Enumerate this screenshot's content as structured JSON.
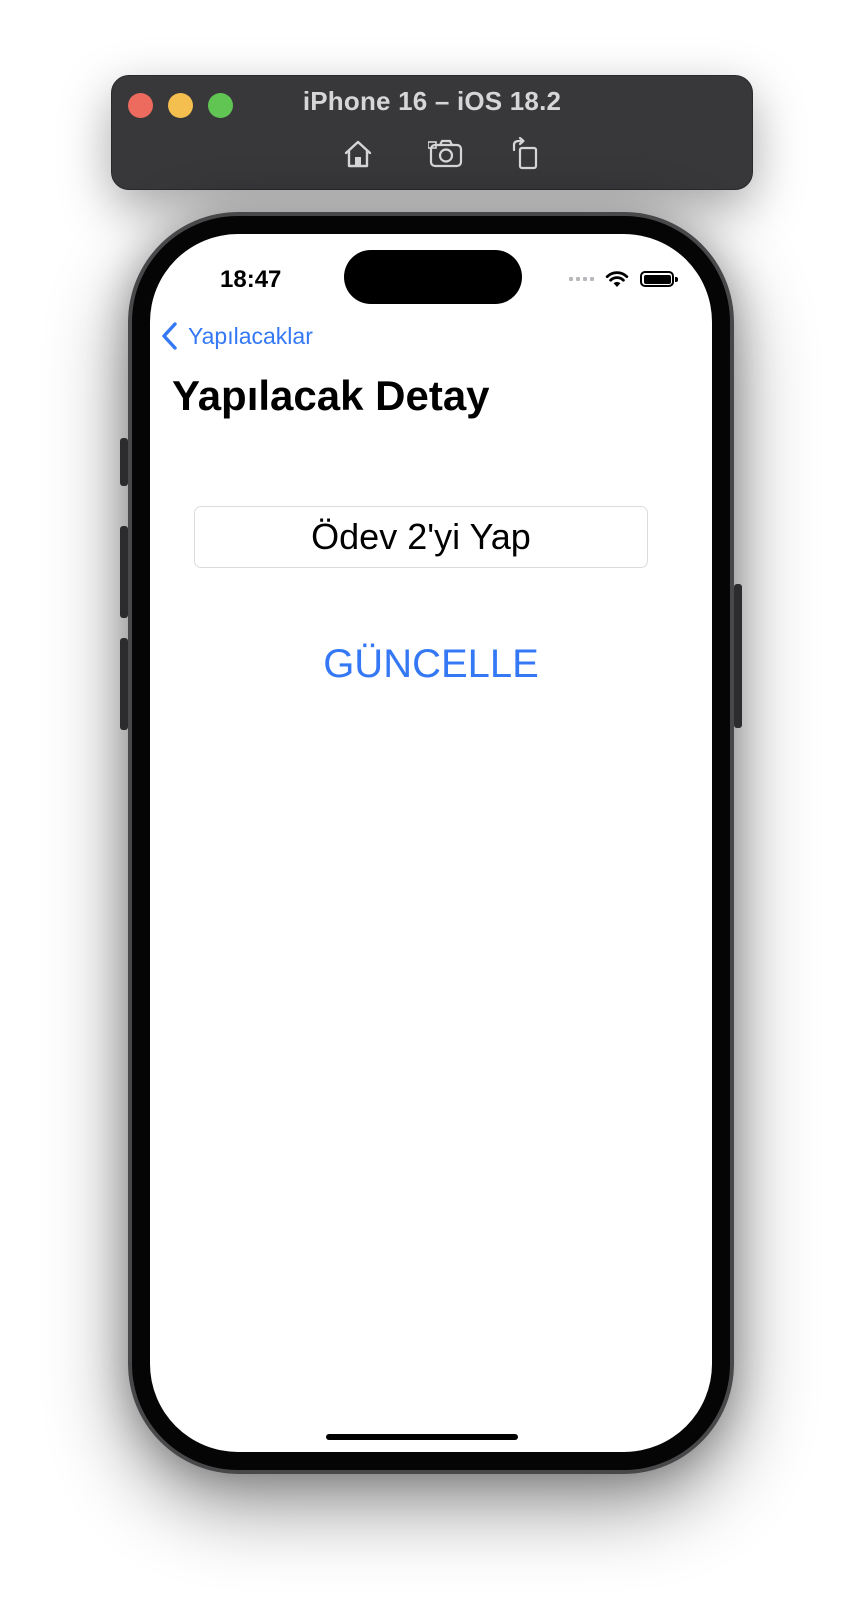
{
  "simulator": {
    "title": "iPhone 16 – iOS 18.2",
    "tools": [
      "home-icon",
      "screenshot-icon",
      "rotate-icon"
    ]
  },
  "status_bar": {
    "time": "18:47",
    "icons": [
      "cellular-icon",
      "wifi-icon",
      "battery-icon"
    ]
  },
  "nav": {
    "back_label": "Yapılacaklar",
    "title": "Yapılacak Detay"
  },
  "form": {
    "todo_value": "Ödev 2'yi Yap",
    "update_label": "GÜNCELLE"
  },
  "colors": {
    "accent": "#3478f6",
    "sim_bar": "#38383b",
    "traffic_red": "#ed6a5e",
    "traffic_yellow": "#f5bf4f",
    "traffic_green": "#61c554"
  }
}
